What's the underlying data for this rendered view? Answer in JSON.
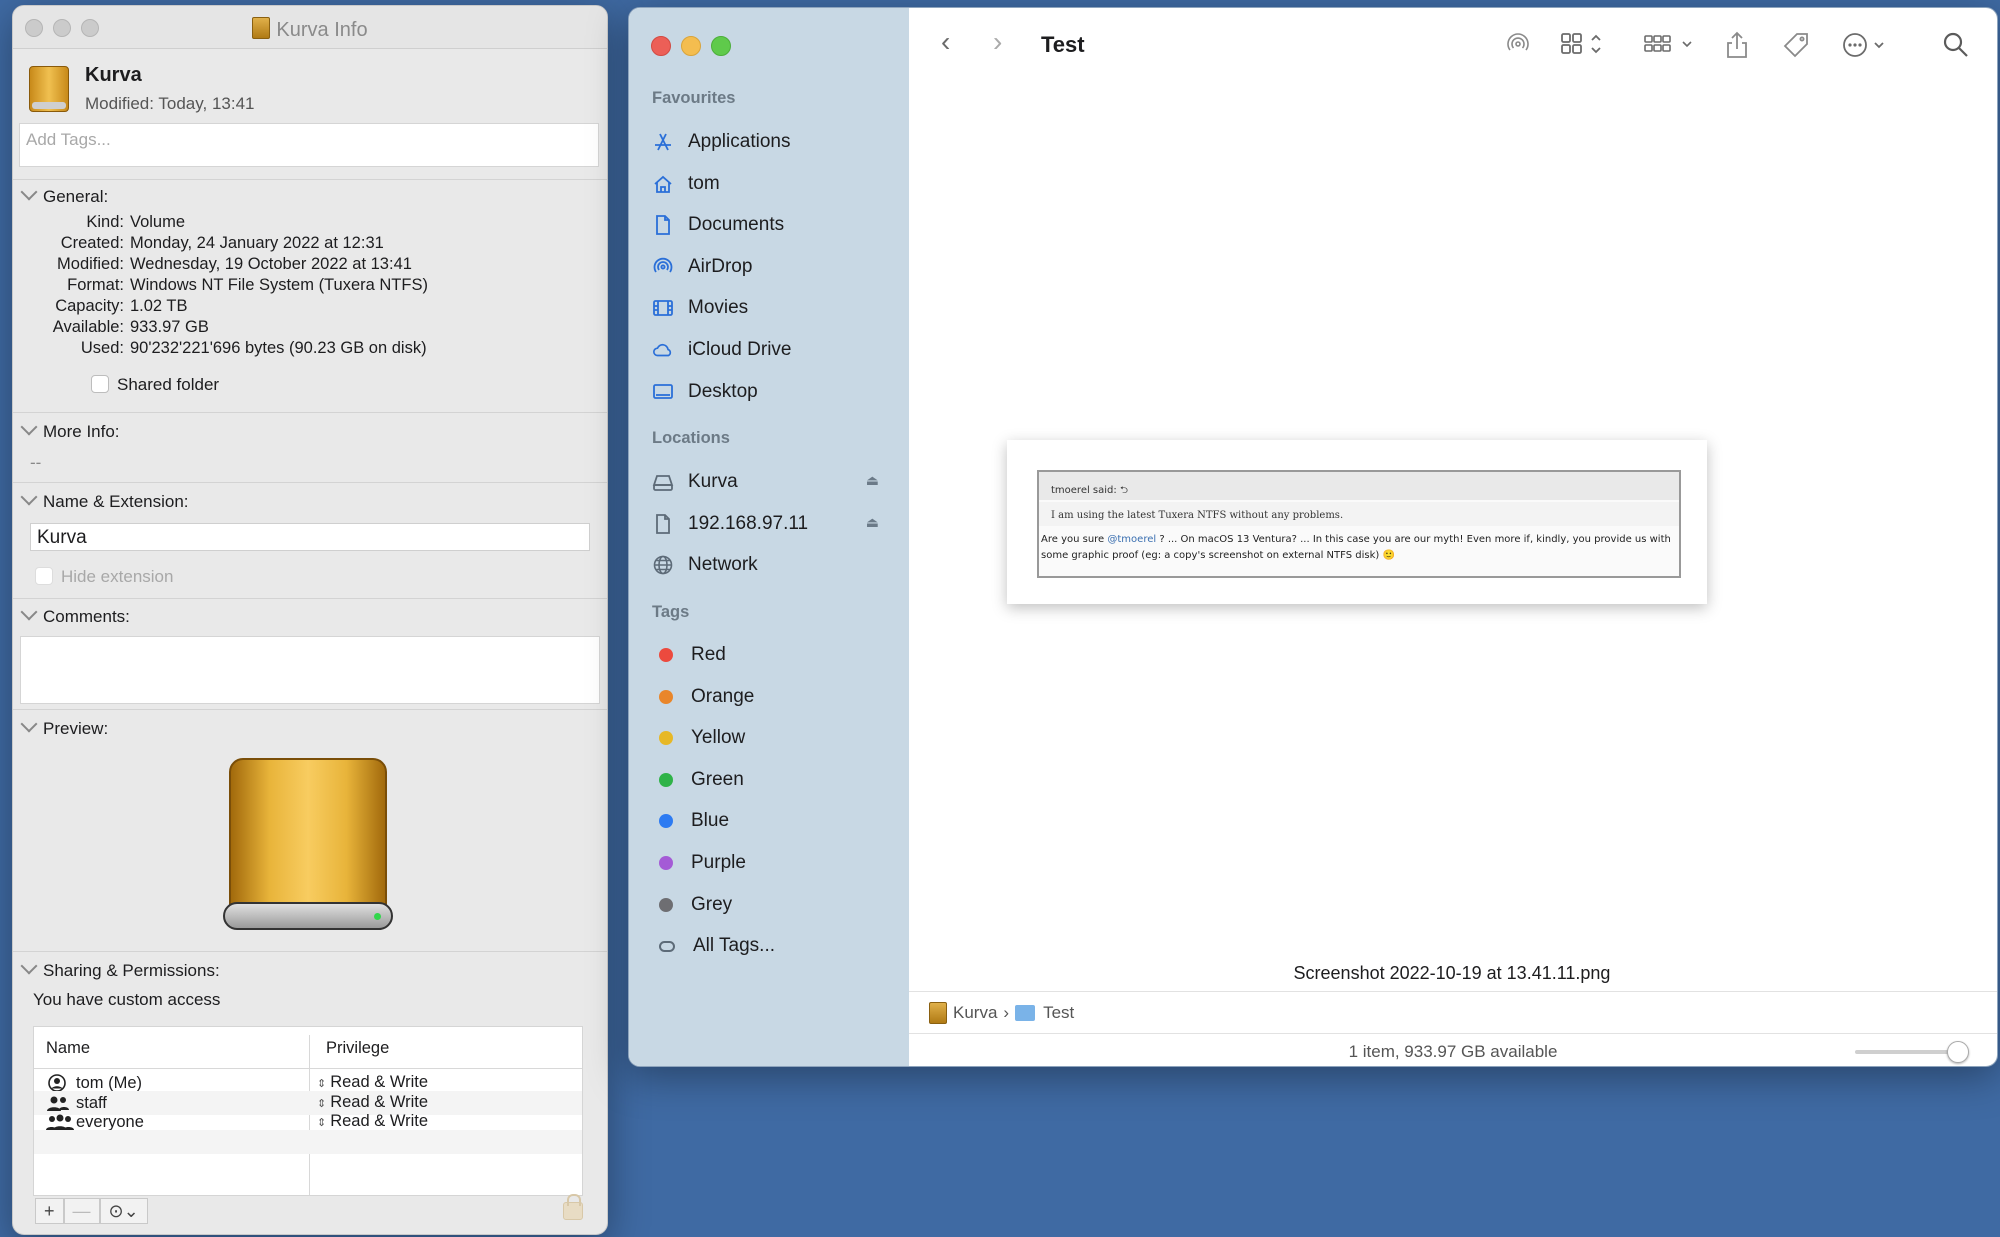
{
  "info": {
    "title": "Kurva Info",
    "name": "Kurva",
    "modified": "Modified: Today, 13:41",
    "tags_placeholder": "Add Tags...",
    "general": {
      "header": "General:",
      "rows": [
        {
          "k": "Kind:",
          "v": "Volume"
        },
        {
          "k": "Created:",
          "v": "Monday, 24 January 2022 at 12:31"
        },
        {
          "k": "Modified:",
          "v": "Wednesday, 19 October 2022 at 13:41"
        },
        {
          "k": "Format:",
          "v": "Windows NT File System (Tuxera NTFS)"
        },
        {
          "k": "Capacity:",
          "v": "1.02 TB"
        },
        {
          "k": "Available:",
          "v": "933.97 GB"
        },
        {
          "k": "Used:",
          "v": "90'232'221'696 bytes (90.23 GB on disk)"
        }
      ],
      "shared_folder": "Shared folder"
    },
    "more_info": {
      "header": "More Info:",
      "value": "--"
    },
    "name_ext": {
      "header": "Name & Extension:",
      "value": "Kurva",
      "hide_ext": "Hide extension"
    },
    "comments": {
      "header": "Comments:"
    },
    "preview": {
      "header": "Preview:"
    },
    "sharing": {
      "header": "Sharing & Permissions:",
      "access": "You have custom access",
      "col_name": "Name",
      "col_priv": "Privilege",
      "rows": [
        {
          "name": "tom (Me)",
          "priv": "Read & Write",
          "icon": "user-icon"
        },
        {
          "name": "staff",
          "priv": "Read & Write",
          "icon": "group-icon"
        },
        {
          "name": "everyone",
          "priv": "Read & Write",
          "icon": "everyone-icon"
        }
      ],
      "buttons": {
        "add": "+",
        "remove": "—",
        "action": "⊙⌄"
      }
    }
  },
  "finder": {
    "title": "Test",
    "sidebar": {
      "favourites_header": "Favourites",
      "favourites": [
        {
          "label": "Applications",
          "icon": "applications-icon"
        },
        {
          "label": "tom",
          "icon": "home-icon"
        },
        {
          "label": "Documents",
          "icon": "document-icon"
        },
        {
          "label": "AirDrop",
          "icon": "airdrop-icon"
        },
        {
          "label": "Movies",
          "icon": "film-icon"
        },
        {
          "label": "iCloud Drive",
          "icon": "cloud-icon"
        },
        {
          "label": "Desktop",
          "icon": "desktop-icon"
        }
      ],
      "locations_header": "Locations",
      "locations": [
        {
          "label": "Kurva",
          "icon": "drive-icon",
          "eject": true
        },
        {
          "label": "192.168.97.11",
          "icon": "server-icon",
          "eject": true
        },
        {
          "label": "Network",
          "icon": "globe-icon",
          "eject": false
        }
      ],
      "tags_header": "Tags",
      "tags": [
        {
          "label": "Red",
          "color": "#ec4a3e"
        },
        {
          "label": "Orange",
          "color": "#e9862a"
        },
        {
          "label": "Yellow",
          "color": "#e7b826"
        },
        {
          "label": "Green",
          "color": "#2fb348"
        },
        {
          "label": "Blue",
          "color": "#2d7bf2"
        },
        {
          "label": "Purple",
          "color": "#a45bd6"
        },
        {
          "label": "Grey",
          "color": "#6e6e72"
        },
        {
          "label": "All Tags...",
          "color": ""
        }
      ]
    },
    "thumbnail": {
      "quote_author": "tmoerel said: ⮌",
      "quote_text": "I am using the latest Tuxera NTFS without any problems.",
      "reply_pre": "Are you sure ",
      "reply_mention": "@tmoerel",
      "reply_post": " ? ... On macOS 13 Ventura? ... In this case you are our myth! Even more if, kindly, you provide us with some graphic proof (eg: a copy's screenshot on external NTFS disk) 🙂"
    },
    "filename": "Screenshot 2022-10-19 at 13.41.11.png",
    "path": {
      "drive": "Kurva",
      "sep": "›",
      "folder": "Test"
    },
    "status": "1 item, 933.97 GB available",
    "accent": "#2a6fd8"
  }
}
